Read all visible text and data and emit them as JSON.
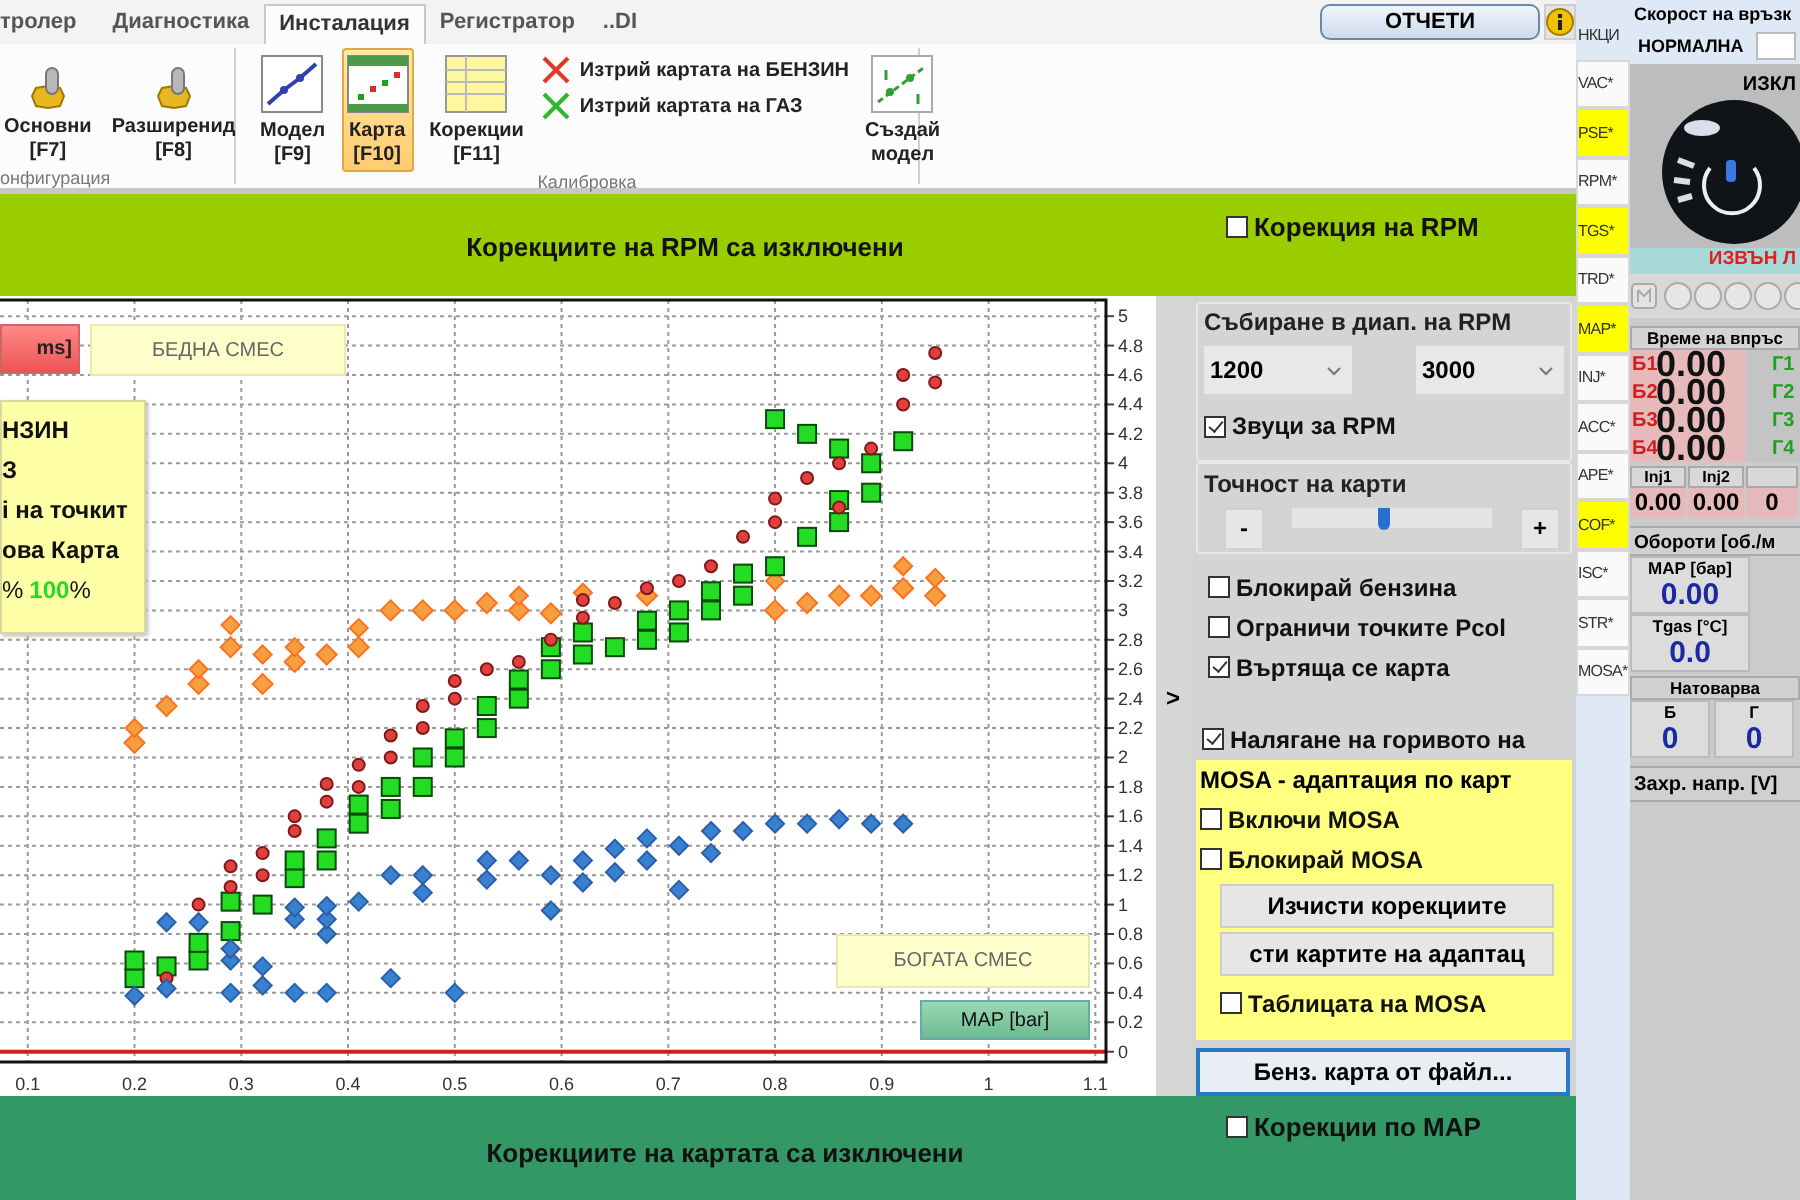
{
  "tabs": [
    {
      "label": "тролер",
      "selected": false
    },
    {
      "label": "Диагностика",
      "selected": false
    },
    {
      "label": "Инсталация",
      "selected": true
    },
    {
      "label": "Регистратор",
      "selected": false
    },
    {
      "label": "..DI",
      "selected": false
    }
  ],
  "reports_button": "ОТЧЕТИ",
  "ribbon": {
    "groups": [
      {
        "label": "онфигурация",
        "items": [
          {
            "kind": "large",
            "lines": [
              "Основни",
              "[F7]"
            ],
            "selected": false
          },
          {
            "kind": "large",
            "lines": [
              "Разширенид",
              "[F8]"
            ],
            "selected": false
          }
        ]
      },
      {
        "label": "Калибровка",
        "items": [
          {
            "kind": "large",
            "lines": [
              "Модел",
              "[F9]"
            ],
            "selected": false
          },
          {
            "kind": "large",
            "lines": [
              "Карта",
              "[F10]"
            ],
            "selected": true
          },
          {
            "kind": "large",
            "lines": [
              "Корекции",
              "[F11]"
            ],
            "selected": false
          },
          {
            "kind": "stack",
            "entries": [
              {
                "label": "Изтрий картата на БЕНЗИН",
                "color": "#e03a28"
              },
              {
                "label": "Изтрий картата на ГАЗ",
                "color": "#2eb82e"
              }
            ]
          },
          {
            "kind": "large",
            "lines": [
              "Създай",
              "модел"
            ],
            "selected": false
          }
        ]
      }
    ]
  },
  "rpm_banner": "Корекциите на RPM са изключени",
  "rpm_correction": {
    "label": "Корекция на RPM",
    "checked": false
  },
  "chart": {
    "unit_box": "ms]",
    "lean_label": "БЕДНА СМЕС",
    "rich_label": "БОГАТА СМЕС",
    "axis_box": "MAP [bar]",
    "info_lines": [
      "НЗИН",
      "З",
      "і на точкит",
      "ова Карта"
    ],
    "info_percent": {
      "before": "%",
      "value": "100",
      "after": "%"
    },
    "chart_data": {
      "type": "scatter",
      "grid": true,
      "ref_lines": [
        {
          "axis": "y",
          "value": 0,
          "color": "#d02020"
        }
      ],
      "xlim": [
        0.074,
        1.11
      ],
      "ylim": [
        -0.07,
        5.11
      ],
      "xticks": [
        0.1,
        0.2,
        0.3,
        0.4,
        0.5,
        0.6,
        0.7,
        0.8,
        0.9,
        1,
        1.1
      ],
      "yticks": [
        0,
        0.2,
        0.4,
        0.6,
        0.8,
        1,
        1.2,
        1.4,
        1.6,
        1.8,
        2,
        2.2,
        2.4,
        2.6,
        2.8,
        3,
        3.2,
        3.4,
        3.6,
        3.8,
        4,
        4.2,
        4.4,
        4.6,
        4.8,
        5
      ],
      "x": [
        0.2,
        0.23,
        0.26,
        0.29,
        0.32,
        0.35,
        0.38,
        0.41,
        0.44,
        0.47,
        0.5,
        0.53,
        0.56,
        0.59,
        0.62,
        0.65,
        0.68,
        0.71,
        0.74,
        0.77,
        0.8,
        0.83,
        0.86,
        0.89,
        0.92,
        0.95
      ],
      "series": [
        {
          "color": "#f5a040",
          "values": [
            2.1,
            2.35,
            2.5,
            2.75,
            2.5,
            2.65,
            2.7,
            2.75,
            3.0,
            3.0,
            3.0,
            3.05,
            3.0,
            2.98,
            null,
            null,
            3.1,
            null,
            null,
            null,
            3.0,
            3.05,
            3.1,
            3.1,
            3.15,
            3.1
          ]
        },
        {
          "color": "#f5a040",
          "values": [
            2.2,
            null,
            2.6,
            2.9,
            2.7,
            2.75,
            null,
            2.88,
            null,
            null,
            null,
            null,
            3.1,
            null,
            3.12,
            null,
            null,
            null,
            null,
            null,
            3.2,
            null,
            null,
            null,
            3.3,
            3.22
          ]
        },
        {
          "color": "#22dd22",
          "values": [
            0.5,
            0.58,
            0.62,
            0.82,
            1.0,
            1.18,
            1.3,
            1.55,
            1.65,
            1.8,
            2.0,
            2.2,
            2.4,
            2.6,
            2.7,
            2.75,
            2.8,
            2.85,
            3.0,
            3.1,
            3.3,
            3.5,
            3.6,
            3.8,
            4.15,
            null
          ]
        },
        {
          "color": "#22dd22",
          "values": [
            0.62,
            null,
            0.74,
            1.02,
            null,
            1.3,
            1.45,
            1.68,
            1.8,
            2.0,
            2.13,
            2.35,
            2.53,
            2.75,
            2.85,
            null,
            2.93,
            3.0,
            3.13,
            3.25,
            4.3,
            4.2,
            3.75,
            4.0,
            null,
            null
          ]
        },
        {
          "color": "#22dd22",
          "values": [
            null,
            null,
            null,
            null,
            null,
            null,
            null,
            null,
            null,
            null,
            null,
            null,
            null,
            null,
            null,
            null,
            null,
            null,
            null,
            null,
            null,
            null,
            4.1,
            null,
            null,
            null
          ]
        },
        {
          "color": "#e04040",
          "values": [
            null,
            0.5,
            1.0,
            1.12,
            1.2,
            1.5,
            1.7,
            1.8,
            2.0,
            2.2,
            2.4,
            2.6,
            2.65,
            2.8,
            2.95,
            3.05,
            3.15,
            3.2,
            3.3,
            3.5,
            3.6,
            3.9,
            3.7,
            4.1,
            4.4,
            4.55
          ]
        },
        {
          "color": "#e04040",
          "values": [
            null,
            null,
            null,
            1.26,
            1.35,
            1.6,
            1.82,
            1.95,
            2.15,
            2.35,
            2.52,
            null,
            null,
            null,
            3.07,
            null,
            null,
            null,
            null,
            null,
            3.76,
            null,
            4.0,
            null,
            4.6,
            4.75
          ]
        },
        {
          "color": "#3a80d0",
          "values": [
            0.38,
            0.43,
            0.88,
            0.4,
            0.45,
            0.4,
            0.4,
            1.02,
            0.5,
            1.08,
            0.4,
            1.17,
            1.3,
            0.96,
            1.15,
            1.22,
            1.3,
            1.1,
            1.35,
            1.5,
            1.55,
            1.55,
            1.58,
            1.55,
            1.55,
            null
          ]
        },
        {
          "color": "#3a80d0",
          "values": [
            null,
            0.88,
            null,
            0.62,
            0.58,
            0.9,
            0.8,
            null,
            1.2,
            1.2,
            null,
            1.3,
            null,
            1.2,
            1.3,
            1.38,
            1.45,
            1.4,
            1.5,
            null,
            null,
            null,
            null,
            null,
            null,
            null
          ]
        },
        {
          "color": "#3a80d0",
          "values": [
            null,
            null,
            null,
            0.7,
            null,
            0.98,
            0.9,
            null,
            null,
            null,
            null,
            null,
            null,
            null,
            null,
            null,
            null,
            null,
            null,
            null,
            null,
            null,
            null,
            null,
            null,
            null
          ]
        },
        {
          "color": "#3a80d0",
          "values": [
            null,
            null,
            null,
            null,
            null,
            null,
            0.99,
            null,
            null,
            null,
            null,
            null,
            null,
            null,
            null,
            null,
            null,
            null,
            null,
            null,
            null,
            null,
            null,
            null,
            null,
            null
          ]
        }
      ]
    }
  },
  "collapse_toggle": ">",
  "rpm_range": {
    "title": "Събиране в диап. на RPM",
    "from": "1200",
    "to": "3000",
    "sounds": {
      "label": "Звуци за RPM",
      "checked": true
    }
  },
  "map_precision": {
    "title": "Точност на карти",
    "minus": "-",
    "plus": "+",
    "level": 0.46
  },
  "options": [
    {
      "label": "Блокирай бензина",
      "checked": false
    },
    {
      "label": "Ограничи точките Pcol",
      "checked": false
    },
    {
      "label": "Въртяща се карта",
      "checked": true
    }
  ],
  "fuel_pressure": {
    "label": "Налягане на горивото на",
    "checked": true
  },
  "mosa": {
    "title": "MOSA - адаптация по карт",
    "options": [
      {
        "label": "Включи MOSA",
        "checked": false
      },
      {
        "label": "Блокирай MOSA",
        "checked": false
      }
    ],
    "buttons": [
      "Изчисти корекциите",
      "сти картите на адаптац"
    ],
    "table": {
      "label": "Таблицата на MOSA",
      "checked": false
    }
  },
  "load_button": "Бенз. карта от файл...",
  "map_banner": "Корекциите на картата са изключени",
  "map_corrections": {
    "label": "Корекции по MAP",
    "checked": false
  },
  "side_tabs": [
    {
      "label": "НКЦИ",
      "highlighted": false,
      "selected": true
    },
    {
      "label": "VAC*",
      "highlighted": false,
      "selected": false
    },
    {
      "label": "PSE*",
      "highlighted": true,
      "selected": false
    },
    {
      "label": "RPM*",
      "highlighted": false,
      "selected": false
    },
    {
      "label": "TGS*",
      "highlighted": true,
      "selected": false
    },
    {
      "label": "TRD*",
      "highlighted": false,
      "selected": false
    },
    {
      "label": "MAP*",
      "highlighted": true,
      "selected": false
    },
    {
      "label": "INJ*",
      "highlighted": false,
      "selected": false
    },
    {
      "label": "ACC*",
      "highlighted": false,
      "selected": false
    },
    {
      "label": "APE*",
      "highlighted": false,
      "selected": false
    },
    {
      "label": "COF*",
      "highlighted": true,
      "selected": false
    },
    {
      "label": "ISC*",
      "highlighted": false,
      "selected": false
    },
    {
      "label": "STR*",
      "highlighted": false,
      "selected": false
    },
    {
      "label": "MOSA*",
      "highlighted": false,
      "selected": false
    }
  ],
  "status": {
    "link_speed_title": "Скорост на връзк",
    "link_speed": "НОРМАЛНА",
    "state": "ИЗКЛ",
    "range_warning": "ИЗВЪН Л",
    "injection_title": "Време на впръс",
    "injection_rows": [
      {
        "petrol_label": "Б1",
        "value": "0.00",
        "gas_label": "Г1"
      },
      {
        "petrol_label": "Б2",
        "value": "0.00",
        "gas_label": "Г2"
      },
      {
        "petrol_label": "Б3",
        "value": "0.00",
        "gas_label": "Г3"
      },
      {
        "petrol_label": "Б4",
        "value": "0.00",
        "gas_label": "Г4"
      }
    ],
    "injectors": [
      {
        "label": "Inj1",
        "value": "0.00"
      },
      {
        "label": "Inj2",
        "value": "0.00"
      },
      {
        "value": "0"
      }
    ],
    "rpm_title": "Обороти [об./м",
    "readings": [
      {
        "label": "MAP [бар]",
        "value": "0.00"
      },
      {
        "label": "Tgas [°C]",
        "value": "0.0"
      }
    ],
    "load_title": "Натоварва",
    "load": [
      {
        "label": "Б",
        "value": "0"
      },
      {
        "label": "Г",
        "value": "0"
      }
    ],
    "voltage_title": "Захр. напр. [V]"
  }
}
